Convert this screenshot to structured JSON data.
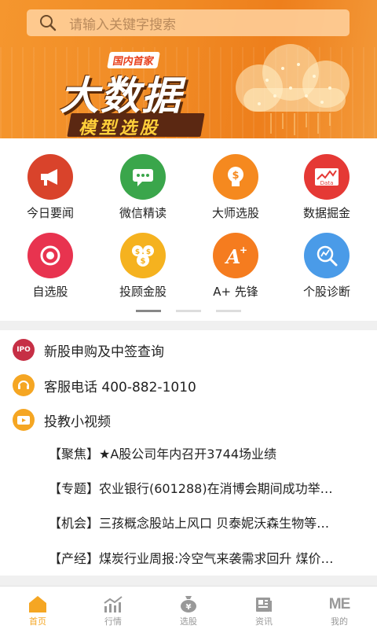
{
  "search": {
    "placeholder": "请输入关键字搜索"
  },
  "banner": {
    "tag": "国内首家",
    "title": "大数据",
    "subtitle": "模型选股"
  },
  "grid": {
    "items": [
      {
        "label": "今日要闻",
        "icon": "megaphone-icon",
        "color": "#d9432b"
      },
      {
        "label": "微信精读",
        "icon": "chat-bubble-icon",
        "color": "#3aa64b"
      },
      {
        "label": "大师选股",
        "icon": "dollar-head-icon",
        "color": "#f5891f"
      },
      {
        "label": "数据掘金",
        "icon": "data-chart-icon",
        "color": "#e53935"
      },
      {
        "label": "自选股",
        "icon": "eye-icon",
        "color": "#e8334f"
      },
      {
        "label": "投顾金股",
        "icon": "coins-icon",
        "color": "#f5b21f"
      },
      {
        "label": "A+ 先锋",
        "icon": "a-plus-icon",
        "color": "#f57c1f"
      },
      {
        "label": "个股诊断",
        "icon": "magnifier-chart-icon",
        "color": "#4a9be8"
      }
    ]
  },
  "list": [
    {
      "label": "新股申购及中签查询",
      "icon": "ipo-icon",
      "icon_text": "IPO",
      "color": "#c62f45"
    },
    {
      "label": "客服电话 400-882-1010",
      "icon": "headset-icon",
      "color": "#f5a623"
    },
    {
      "label": "投教小视频",
      "icon": "video-icon",
      "color": "#f5a623"
    }
  ],
  "news": [
    "【聚焦】★A股公司年内召开3744场业绩",
    "【专题】农业银行(601288)在消博会期间成功举…",
    "【机会】三孩概念股站上风口 贝泰妮沃森生物等…",
    "【产经】煤炭行业周报:冷空气来袭需求回升 煤价…"
  ],
  "tabs": [
    {
      "label": "首页",
      "icon": "home-icon",
      "active": true
    },
    {
      "label": "行情",
      "icon": "trend-chart-icon",
      "active": false
    },
    {
      "label": "选股",
      "icon": "money-bag-icon",
      "active": false
    },
    {
      "label": "资讯",
      "icon": "news-icon",
      "active": false
    },
    {
      "label": "我的",
      "icon": "me-icon",
      "icon_text": "ME",
      "active": false
    }
  ],
  "colors": {
    "accent": "#f5a623",
    "banner": "#f08a24"
  }
}
